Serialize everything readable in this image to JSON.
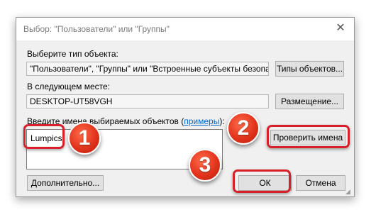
{
  "dialog": {
    "title": "Выбор: \"Пользователи\" или \"Группы\"",
    "close_glyph": "✕",
    "object_type_label": "Выберите тип объекта:",
    "object_type_value": "\"Пользователи\", \"Группы\" или \"Встроенные субъекты безопасно",
    "object_types_button": "Типы объектов...",
    "location_label": "В следующем месте:",
    "location_value": "DESKTOP-UT58VGH",
    "location_button": "Размещение...",
    "names_label_before": "Введите имена выбираемых объектов (",
    "names_label_link": "примеры",
    "names_label_after": "):",
    "names_value": "Lumpics",
    "check_names_button": "Проверить имена",
    "advanced_button": "Дополнительно...",
    "ok_button": "ОК",
    "cancel_button": "Отмена"
  },
  "annotations": {
    "badge_1": "1",
    "badge_2": "2",
    "badge_3": "3",
    "highlight_color": "#d8202a",
    "badge_color": "#e2341c"
  }
}
